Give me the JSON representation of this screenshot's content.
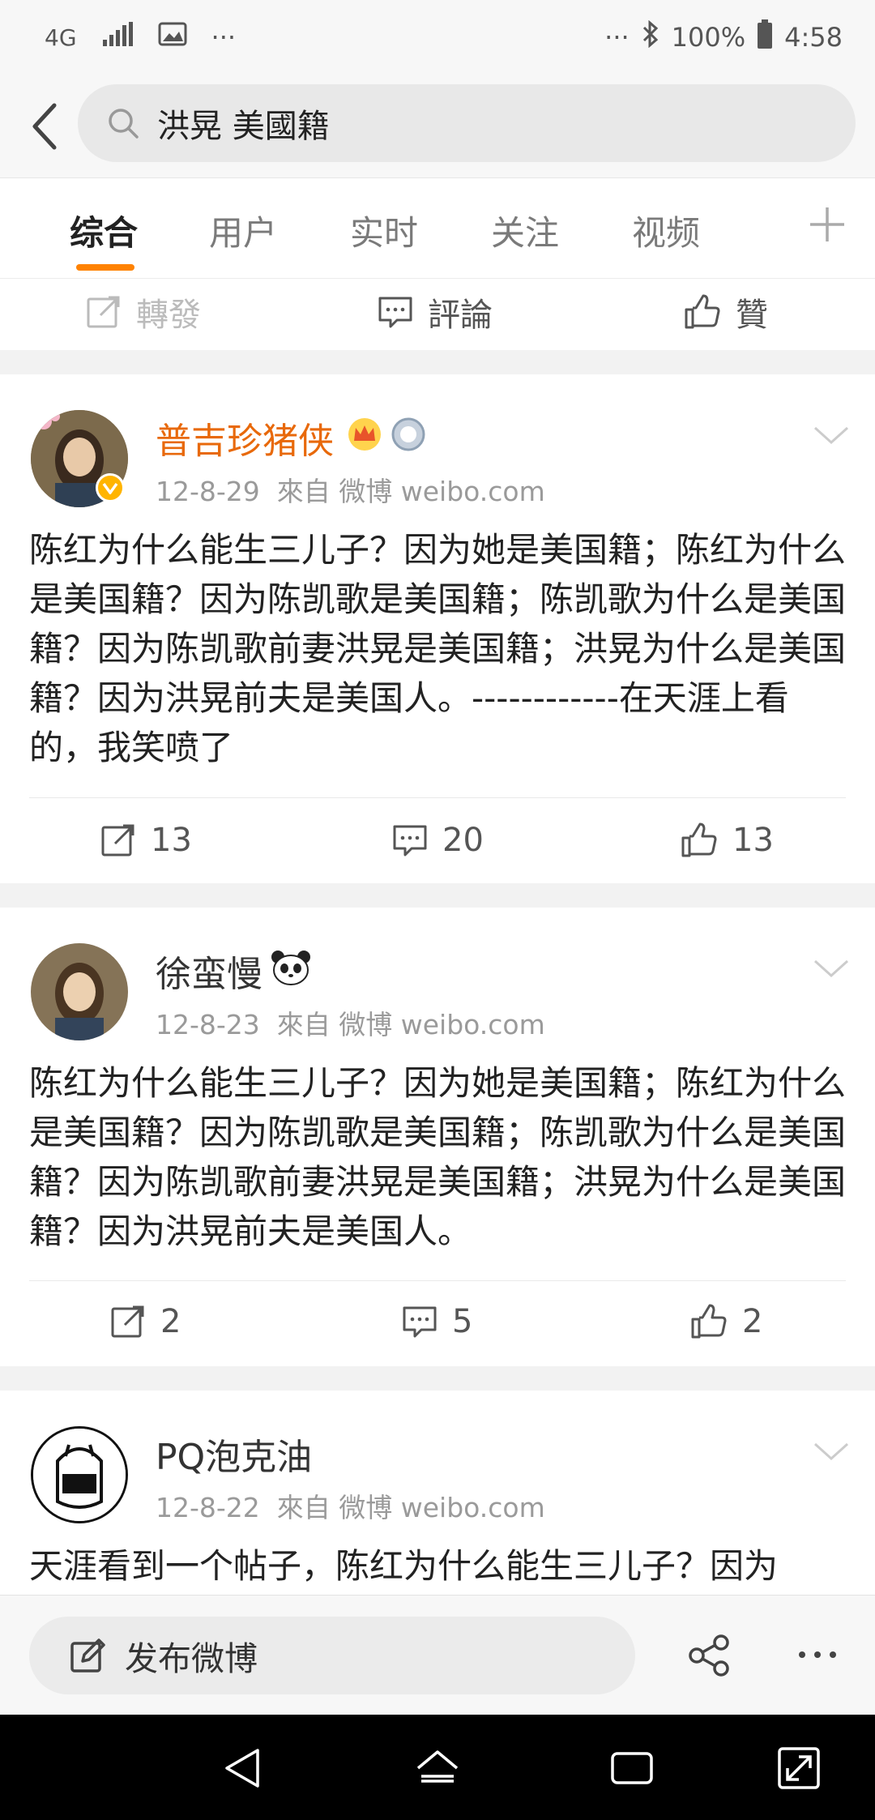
{
  "status_bar": {
    "network": "4G",
    "more": "···",
    "battery": "100%",
    "time": "4:58"
  },
  "search": {
    "query": "洪晃 美國籍"
  },
  "tabs": [
    {
      "label": "综合",
      "active": true
    },
    {
      "label": "用户",
      "active": false
    },
    {
      "label": "实时",
      "active": false
    },
    {
      "label": "关注",
      "active": false
    },
    {
      "label": "视频",
      "active": false
    }
  ],
  "prev_actions": {
    "repost": "轉發",
    "comment": "評論",
    "like": "贊"
  },
  "posts": [
    {
      "username": "普吉珍猪侠",
      "date": "12-8-29",
      "source": "來自 微博 weibo.com",
      "text": "陈红为什么能生三儿子？因为她是美国籍；陈红为什么是美国籍？因为陈凯歌是美国籍；陈凯歌为什么是美国籍？因为陈凯歌前妻洪晃是美国籍；洪晃为什么是美国籍？因为洪晃前夫是美国人。------------在天涯上看的，我笑喷了",
      "reposts": "13",
      "comments": "20",
      "likes": "13"
    },
    {
      "username": "徐蛮慢",
      "date": "12-8-23",
      "source": "來自 微博 weibo.com",
      "text": "陈红为什么能生三儿子？因为她是美国籍；陈红为什么是美国籍？因为陈凯歌是美国籍；陈凯歌为什么是美国籍？因为陈凯歌前妻洪晃是美国籍；洪晃为什么是美国籍？因为洪晃前夫是美国人。",
      "reposts": "2",
      "comments": "5",
      "likes": "2"
    },
    {
      "username": "PQ泡克油",
      "date": "12-8-22",
      "source": "來自 微博 weibo.com",
      "text": "天涯看到一个帖子，陈红为什么能生三儿子？因为"
    }
  ],
  "compose": {
    "label": "发布微博"
  },
  "colors": {
    "accent": "#ff8200",
    "vip_name": "#e8690b",
    "text": "#222222",
    "meta": "#9a9a9a"
  }
}
